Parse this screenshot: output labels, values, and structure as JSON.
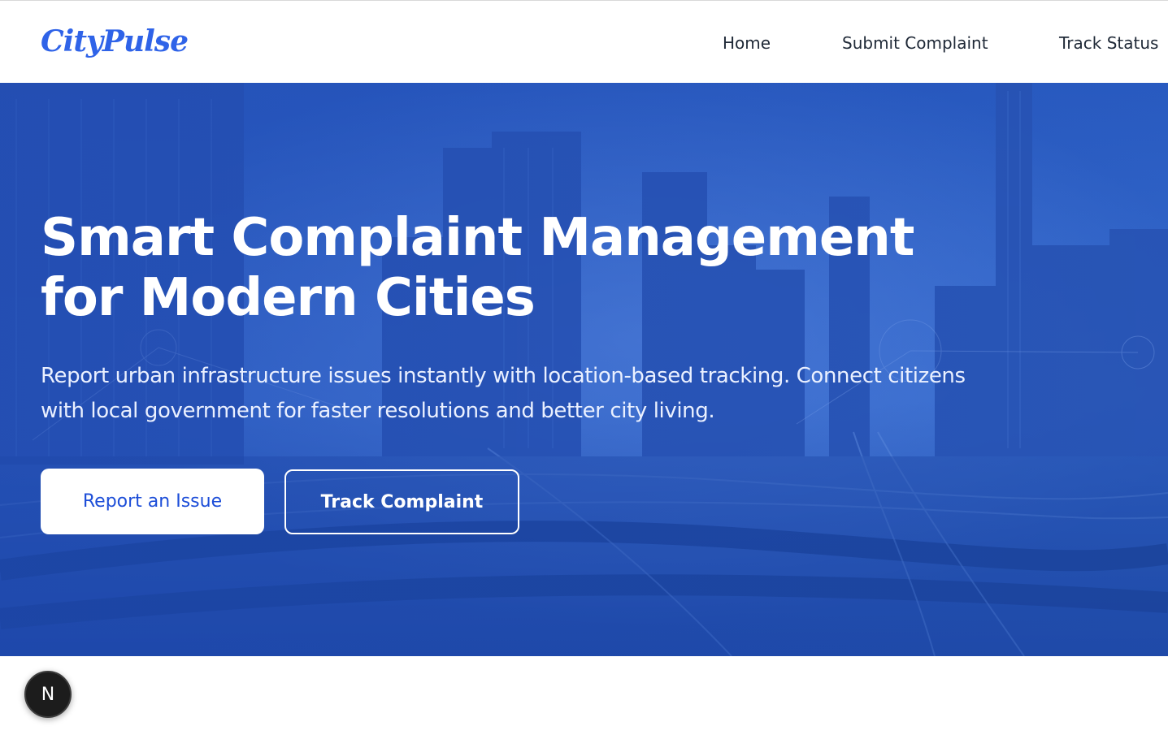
{
  "brand": {
    "name": "CityPulse",
    "color": "#2f63e8"
  },
  "nav": {
    "items": [
      {
        "label": "Home"
      },
      {
        "label": "Submit Complaint"
      },
      {
        "label": "Track Status"
      }
    ]
  },
  "hero": {
    "title": "Smart Complaint Management for Modern Cities",
    "subtitle": "Report urban infrastructure issues instantly with location-based tracking. Connect citizens with local government for faster resolutions and better city living.",
    "primary_button": "Report an Issue",
    "secondary_button": "Track Complaint",
    "background": "city-skyline-highways-image",
    "overlay_color": "#2352b9"
  },
  "dev_badge": {
    "label": "N",
    "icon": "nextjs-icon"
  }
}
